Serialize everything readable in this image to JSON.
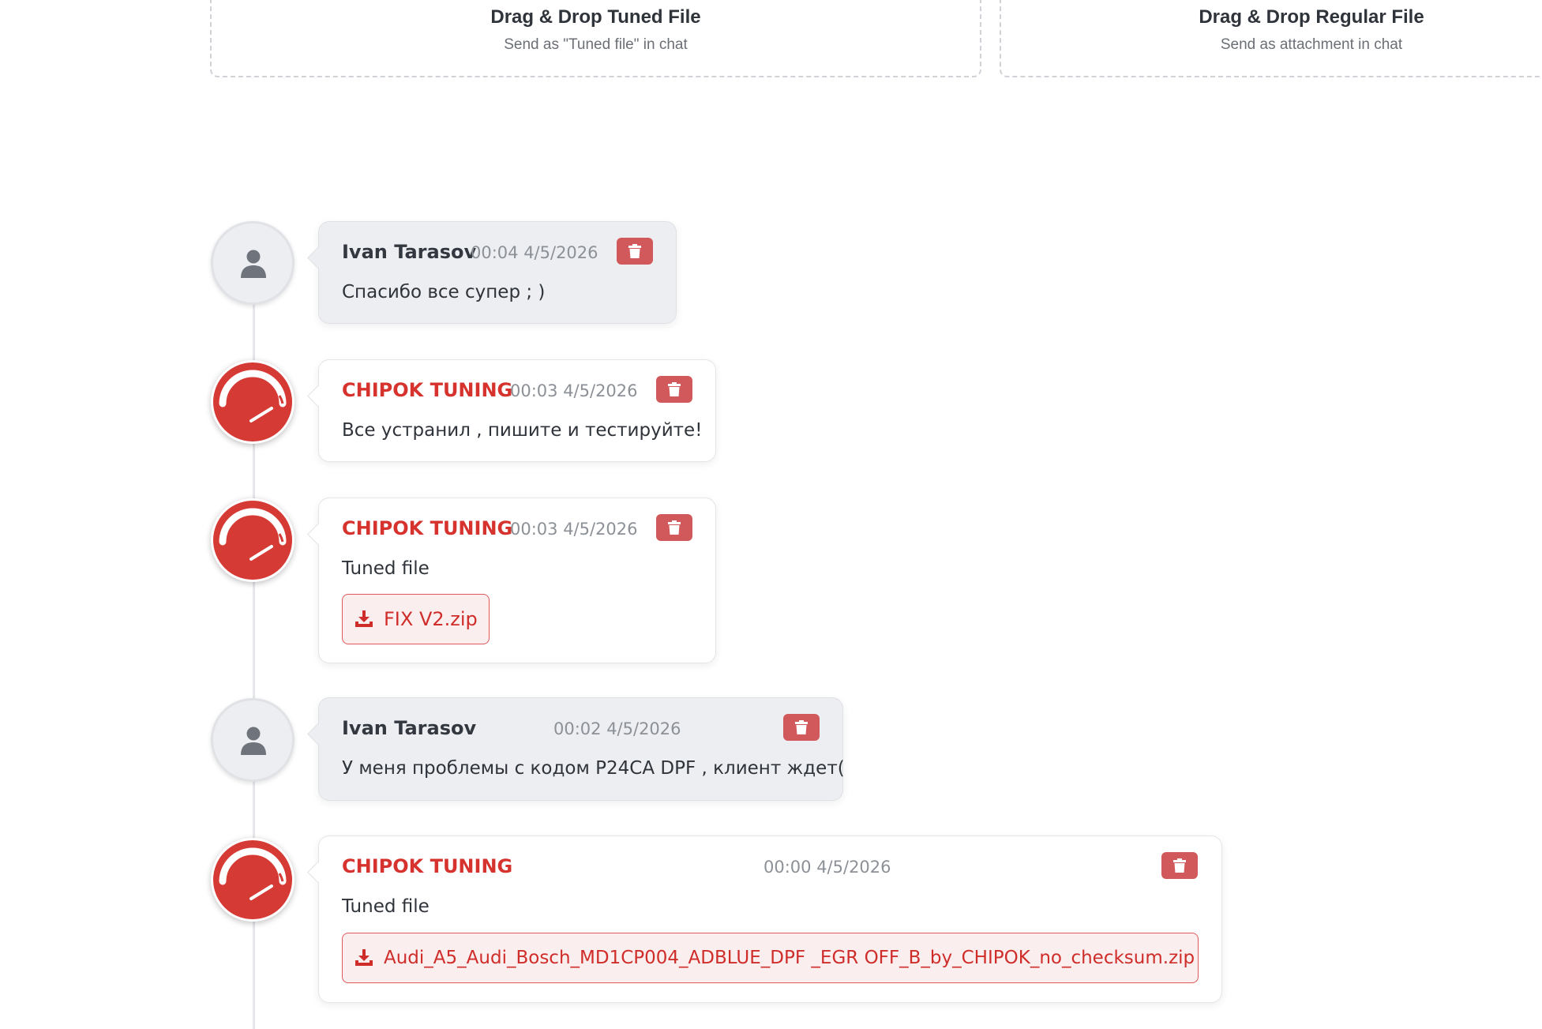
{
  "dropzones": {
    "tuned": {
      "title": "Drag & Drop Tuned File",
      "subtitle": "Send as \"Tuned file\" in chat"
    },
    "regular": {
      "title": "Drag & Drop Regular File",
      "subtitle": "Send as attachment in chat"
    }
  },
  "messages": [
    {
      "author": "Ivan Tarasov",
      "role": "user",
      "time": "00:04 4/5/2026",
      "text": "Спасибо все супер ; )"
    },
    {
      "author": "CHIPOK TUNING",
      "role": "brand",
      "time": "00:03 4/5/2026",
      "text": "Все устранил , пишите и тестируйте!"
    },
    {
      "author": "CHIPOK TUNING",
      "role": "brand",
      "time": "00:03 4/5/2026",
      "text": "Tuned file",
      "file": "FIX V2.zip"
    },
    {
      "author": "Ivan Tarasov",
      "role": "user",
      "time": "00:02 4/5/2026",
      "text": "У меня проблемы с кодом P24CA DPF , клиент ждет("
    },
    {
      "author": "CHIPOK TUNING",
      "role": "brand",
      "time": "00:00 4/5/2026",
      "text": "Tuned file",
      "file": "Audi_A5_Audi_Bosch_MD1CP004_ADBLUE_DPF _EGR OFF_B_by_CHIPOK_no_checksum.zip"
    }
  ],
  "icons": {
    "user_avatar": "user-silhouette-icon",
    "brand_avatar": "speedometer-icon",
    "delete": "trash-icon",
    "download": "download-icon"
  },
  "colors": {
    "brand": "#d6332e",
    "delete_button": "#d2595b",
    "user_bubble": "#eceef1"
  }
}
